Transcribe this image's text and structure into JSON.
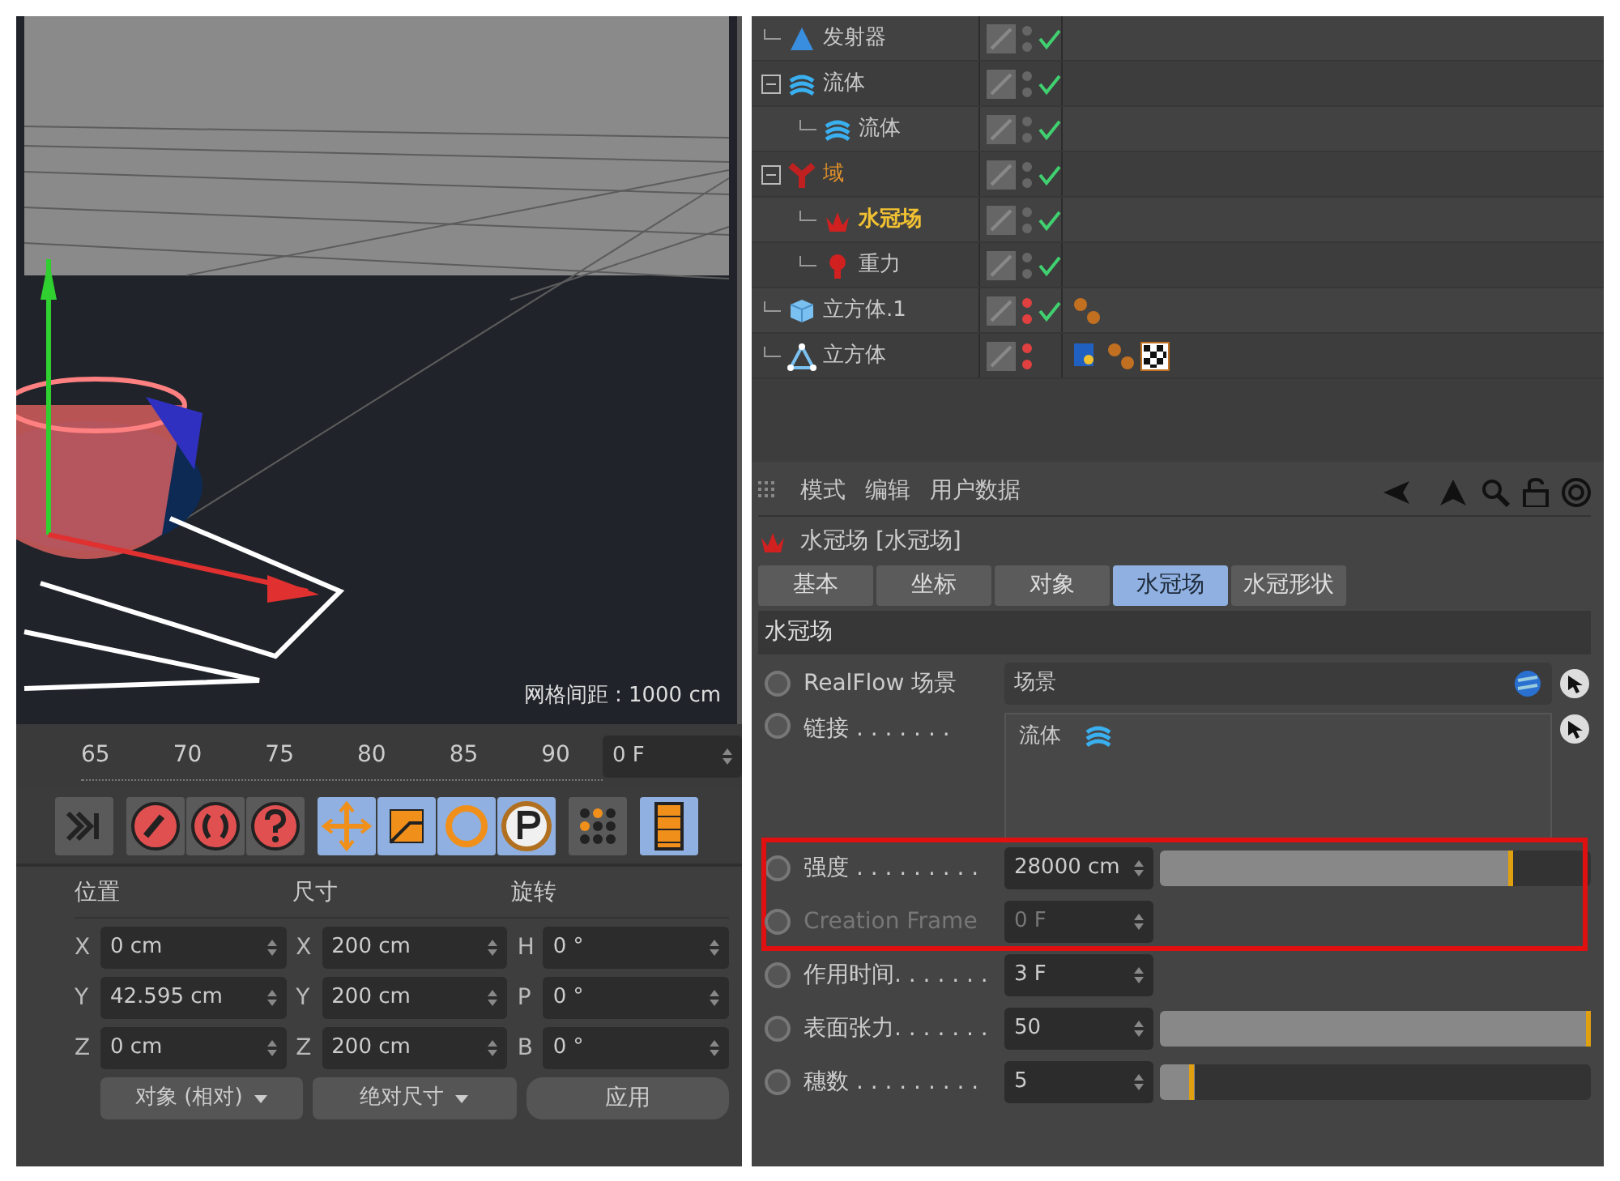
{
  "viewport": {
    "grid_label": "网格间距 : 1000 cm"
  },
  "timeline": {
    "ticks": [
      "65",
      "70",
      "75",
      "80",
      "85",
      "90"
    ],
    "frame": "0 F"
  },
  "toolbar": [
    {
      "kind": "end",
      "on": false
    },
    {
      "kind": "key",
      "on": false
    },
    {
      "kind": "autokey",
      "on": false
    },
    {
      "kind": "keyhelp",
      "on": false
    },
    {
      "kind": "move",
      "on": true
    },
    {
      "kind": "scale",
      "on": true
    },
    {
      "kind": "rotate",
      "on": true
    },
    {
      "kind": "param",
      "on": true
    },
    {
      "kind": "points",
      "on": false
    },
    {
      "kind": "film",
      "on": true
    }
  ],
  "coordinates": {
    "headers": [
      "位置",
      "尺寸",
      "旋转"
    ],
    "rows": [
      {
        "cells": [
          {
            "axis": "X",
            "value": "0 cm"
          },
          {
            "axis": "X",
            "value": "200 cm"
          },
          {
            "axis": "H",
            "value": "0 °"
          }
        ]
      },
      {
        "cells": [
          {
            "axis": "Y",
            "value": "42.595 cm"
          },
          {
            "axis": "Y",
            "value": "200 cm"
          },
          {
            "axis": "P",
            "value": "0 °"
          }
        ]
      },
      {
        "cells": [
          {
            "axis": "Z",
            "value": "0 cm"
          },
          {
            "axis": "Z",
            "value": "200 cm"
          },
          {
            "axis": "B",
            "value": "0 °"
          }
        ]
      }
    ],
    "mode": "对象 (相对)",
    "size_mode": "绝对尺寸",
    "apply": "应用"
  },
  "objects": [
    {
      "name": "发射器",
      "kind": "emitter",
      "selected": false,
      "color": "#c8c8c8",
      "hidden_editor": false,
      "hidden_render": false,
      "enabled": true
    },
    {
      "name": "流体",
      "kind": "fluid",
      "selected": false,
      "color": "#c8c8c8",
      "hidden_editor": false,
      "hidden_render": false,
      "enabled": true,
      "expanded": true,
      "children": [
        {
          "name": "流体",
          "kind": "fluid",
          "selected": false,
          "color": "#c8c8c8",
          "hidden_editor": false,
          "hidden_render": false,
          "enabled": true
        }
      ]
    },
    {
      "name": "域",
      "kind": "domain",
      "selected": false,
      "color": "#e0902a",
      "hidden_editor": false,
      "hidden_render": false,
      "enabled": true,
      "expanded": true,
      "children": [
        {
          "name": "水冠场",
          "kind": "crown",
          "selected": true,
          "color": "#f2c232",
          "hidden_editor": false,
          "hidden_render": false,
          "enabled": true
        },
        {
          "name": "重力",
          "kind": "gravity",
          "selected": false,
          "color": "#c8c8c8",
          "hidden_editor": false,
          "hidden_render": false,
          "enabled": true
        }
      ]
    },
    {
      "name": "立方体.1",
      "kind": "cube",
      "selected": false,
      "color": "#c8c8c8",
      "hidden_editor": true,
      "hidden_render": true,
      "enabled": true,
      "tags": [
        {
          "kind": "balls"
        }
      ]
    },
    {
      "name": "立方体",
      "kind": "polygon",
      "selected": false,
      "color": "#c8c8c8",
      "hidden_editor": true,
      "hidden_render": true,
      "enabled": false,
      "tags": [
        {
          "kind": "uvw"
        },
        {
          "kind": "balls"
        },
        {
          "kind": "checker"
        }
      ]
    }
  ],
  "attributes": {
    "menu": [
      "模式",
      "编辑",
      "用户数据"
    ],
    "title": "水冠场 [水冠场]",
    "tabs": [
      {
        "label": "基本",
        "selected": false
      },
      {
        "label": "坐标",
        "selected": false
      },
      {
        "label": "对象",
        "selected": false
      },
      {
        "label": "水冠场",
        "selected": true
      },
      {
        "label": "水冠形状",
        "selected": false
      }
    ],
    "section": "水冠场",
    "params": [
      {
        "kind": "link",
        "label": "RealFlow 场景",
        "value": "场景",
        "disabled": false,
        "animated": false
      },
      {
        "kind": "list",
        "label": "链接 . . . . . . .",
        "value": "流体",
        "disabled": false,
        "animated": false
      },
      {
        "kind": "slider",
        "label": "强度 . . . . . . . . .",
        "value": "28000 cm",
        "level": 0.82,
        "disabled": false,
        "animated": false,
        "highlighted": true
      },
      {
        "kind": "number",
        "label": "Creation Frame",
        "value": "0 F",
        "disabled": true,
        "animated": false
      },
      {
        "kind": "number",
        "label": "作用时间. . . . . . .",
        "value": "3 F",
        "disabled": false,
        "animated": false
      },
      {
        "kind": "slider",
        "label": "表面张力. . . . . . .",
        "value": "50",
        "level": 1,
        "disabled": false,
        "animated": false
      },
      {
        "kind": "slider",
        "label": "穗数 . . . . . . . . .",
        "value": "5",
        "level": 0.08,
        "disabled": false,
        "animated": false
      }
    ]
  }
}
